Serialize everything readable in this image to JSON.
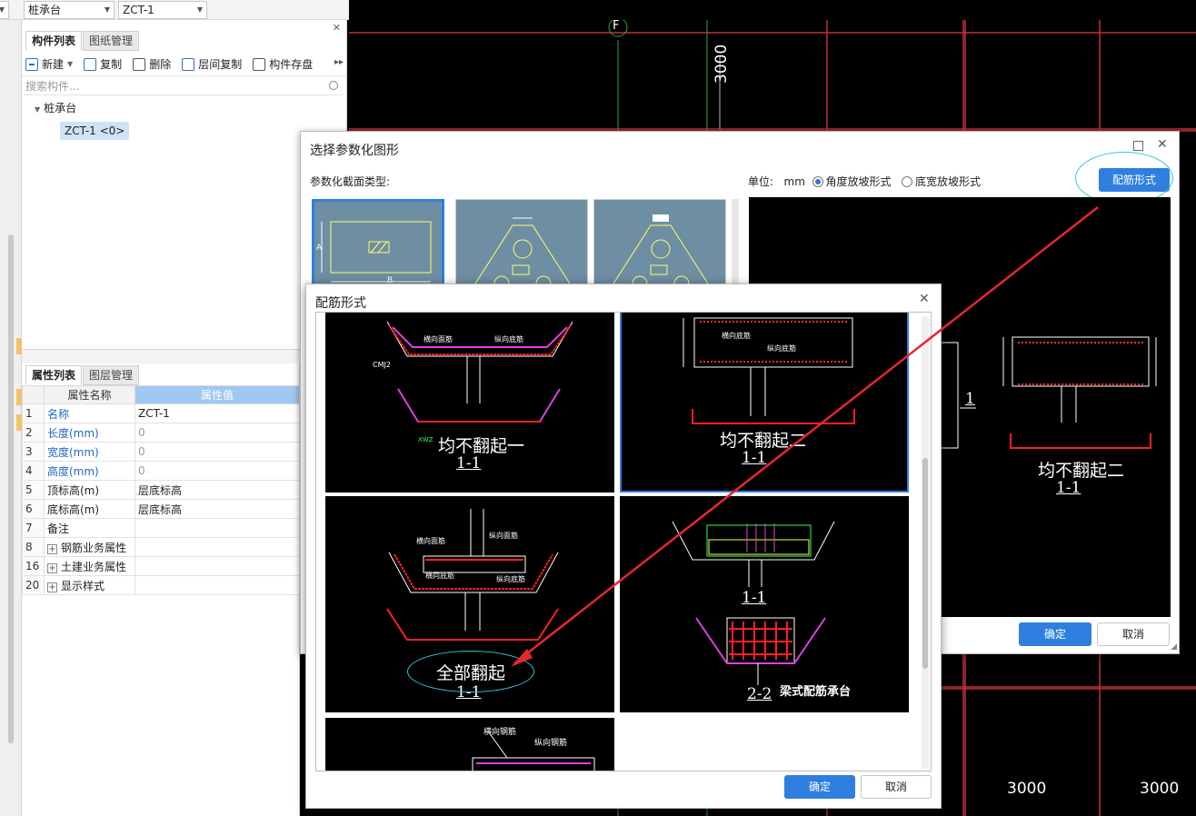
{
  "topbar": {
    "combo1": "桩承台",
    "combo2": "ZCT-1"
  },
  "complist": {
    "tabs": [
      "构件列表",
      "图纸管理"
    ],
    "toolbar": {
      "new": "新建",
      "copy": "复制",
      "delete": "删除",
      "floor_copy": "层间复制",
      "save": "构件存盘"
    },
    "search_placeholder": "搜索构件...",
    "tree_root": "桩承台",
    "tree_child": "ZCT-1 <0>"
  },
  "proplist": {
    "tabs": [
      "属性列表",
      "图层管理"
    ],
    "headers": [
      "属性名称",
      "属性值"
    ],
    "rows": [
      {
        "num": "1",
        "name": "名称",
        "value": "ZCT-1"
      },
      {
        "num": "2",
        "name": "长度(mm)",
        "value": "0"
      },
      {
        "num": "3",
        "name": "宽度(mm)",
        "value": "0"
      },
      {
        "num": "4",
        "name": "高度(mm)",
        "value": "0"
      },
      {
        "num": "5",
        "name": "顶标高(m)",
        "value": "层底标高"
      },
      {
        "num": "6",
        "name": "底标高(m)",
        "value": "层底标高"
      },
      {
        "num": "7",
        "name": "备注",
        "value": ""
      },
      {
        "num": "8",
        "name": "钢筋业务属性",
        "value": ""
      },
      {
        "num": "16",
        "name": "土建业务属性",
        "value": ""
      },
      {
        "num": "20",
        "name": "显示样式",
        "value": ""
      }
    ]
  },
  "cad": {
    "axis_label": "F",
    "dim_vertical": "3000",
    "dim_bottom_1": "3000",
    "dim_bottom_2": "3000"
  },
  "dialog1": {
    "title": "选择参数化图形",
    "section_label": "参数化截面类型:",
    "unit_label": "单位:",
    "unit_value": "mm",
    "radio_angle": "角度放坡形式",
    "radio_width": "底宽放坡形式",
    "rebar_button": "配筋形式",
    "ok": "确定",
    "cancel": "取消",
    "thumb_label_a": "A",
    "thumb_label_b": "B",
    "preview_caption": "均不翻起二",
    "preview_section": "1-1",
    "preview_left_section": "1"
  },
  "dialog2": {
    "title": "配筋形式",
    "cells": [
      {
        "caption": "均不翻起一",
        "section": "1-1"
      },
      {
        "caption": "均不翻起二",
        "section": "1-1"
      },
      {
        "caption": "全部翻起",
        "section": "1-1"
      },
      {
        "caption": "梁式配筋承台",
        "section": "2-2",
        "section_top": "1-1"
      },
      {
        "caption": "",
        "section": ""
      }
    ],
    "cell5_labels": [
      "横向钢筋",
      "纵向钢筋"
    ],
    "ok": "确定",
    "cancel": "取消"
  }
}
